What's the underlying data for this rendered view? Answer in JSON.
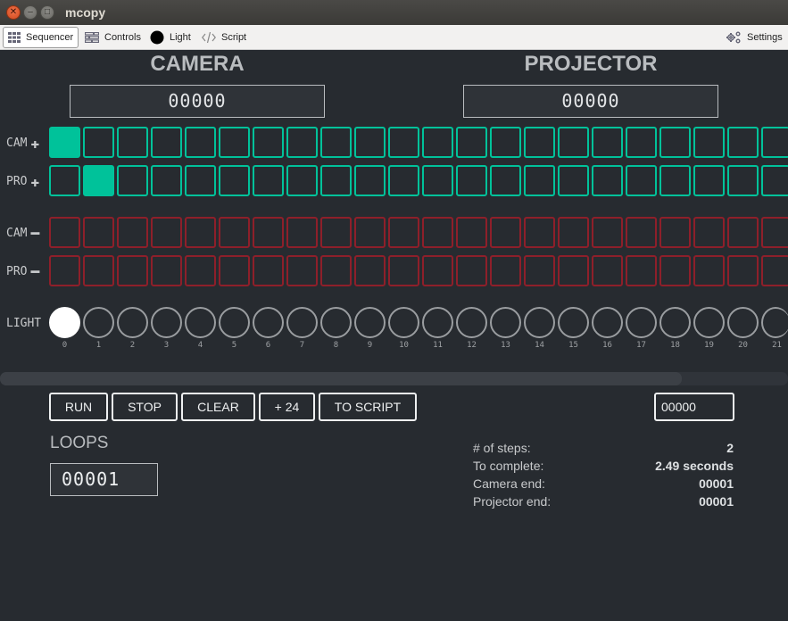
{
  "window": {
    "title": "mcopy",
    "close_glyph": "✕",
    "min_glyph": "–",
    "max_glyph": "□"
  },
  "menu": {
    "sequencer": "Sequencer",
    "controls": "Controls",
    "light": "Light",
    "script": "Script",
    "settings": "Settings"
  },
  "camera": {
    "heading": "CAMERA",
    "counter": "00000"
  },
  "projector": {
    "heading": "PROJECTOR",
    "counter": "00000"
  },
  "rows": {
    "cam_plus": {
      "label": "CAM",
      "sign": "✚"
    },
    "pro_plus": {
      "label": "PRO",
      "sign": "✚"
    },
    "cam_minus": {
      "label": "CAM",
      "sign": "━"
    },
    "pro_minus": {
      "label": "PRO",
      "sign": "━"
    },
    "light": {
      "label": "LIGHT"
    }
  },
  "sequence": {
    "indices": [
      "0",
      "1",
      "2",
      "3",
      "4",
      "5",
      "6",
      "7",
      "8",
      "9",
      "10",
      "11",
      "12",
      "13",
      "14",
      "15",
      "16",
      "17",
      "18",
      "19",
      "20",
      "21"
    ],
    "cam_plus_on": [
      0
    ],
    "pro_plus_on": [
      1
    ],
    "light_on": [
      0
    ]
  },
  "colors": {
    "accent": "#00c29a",
    "negative": "#8e1f2a",
    "background": "#272b30"
  },
  "scroll": {
    "position_fraction": 0.0,
    "visible_fraction": 0.865
  },
  "buttons": {
    "run": "RUN",
    "stop": "STOP",
    "clear": "CLEAR",
    "add24": "+ 24",
    "to_script": "TO SCRIPT"
  },
  "jump_field": {
    "value": "00000"
  },
  "loops": {
    "label": "LOOPS",
    "value": "00001"
  },
  "stats": {
    "steps_label": "# of steps:",
    "steps_value": "2",
    "complete_label": "To complete:",
    "complete_value": "2.49 seconds",
    "cam_end_label": "Camera end:",
    "cam_end_value": "00001",
    "proj_end_label": "Projector end:",
    "proj_end_value": "00001"
  }
}
